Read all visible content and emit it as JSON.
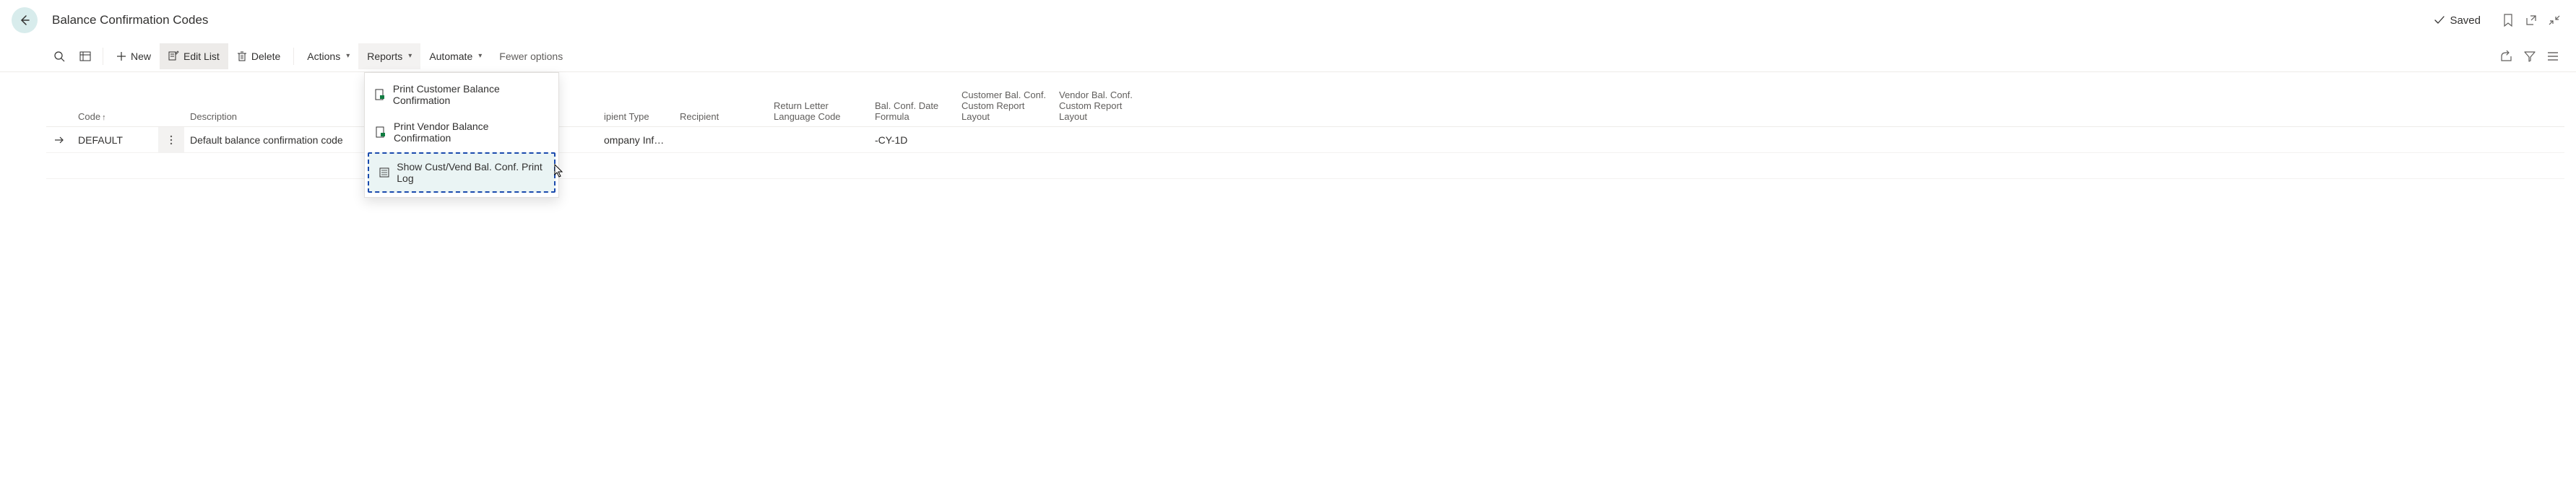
{
  "header": {
    "title": "Balance Confirmation Codes",
    "saved_label": "Saved"
  },
  "toolbar": {
    "new_label": "New",
    "edit_list_label": "Edit List",
    "delete_label": "Delete",
    "actions_label": "Actions",
    "reports_label": "Reports",
    "automate_label": "Automate",
    "fewer_options_label": "Fewer options"
  },
  "reports_menu": {
    "items": [
      {
        "label": "Print Customer Balance Confirmation"
      },
      {
        "label": "Print Vendor Balance Confirmation"
      },
      {
        "label": "Show Cust/Vend Bal. Conf. Print Log"
      }
    ]
  },
  "grid": {
    "columns": {
      "code": "Code",
      "description": "Description",
      "recipient_type": "Recipient Type",
      "recipient": "Recipient",
      "return_letter_lang": "Return Letter Language Code",
      "bal_conf_date": "Bal. Conf. Date Formula",
      "cust_layout": "Customer Bal. Conf. Custom Report Layout",
      "vend_layout": "Vendor Bal. Conf. Custom Report Layout"
    },
    "rows": [
      {
        "code": "DEFAULT",
        "description": "Default balance confirmation code",
        "recipient_type_partial": "ompany Infor...",
        "recipient": "",
        "return_letter_lang": "",
        "bal_conf_date": "-CY-1D",
        "cust_layout": "",
        "vend_layout": ""
      }
    ]
  }
}
